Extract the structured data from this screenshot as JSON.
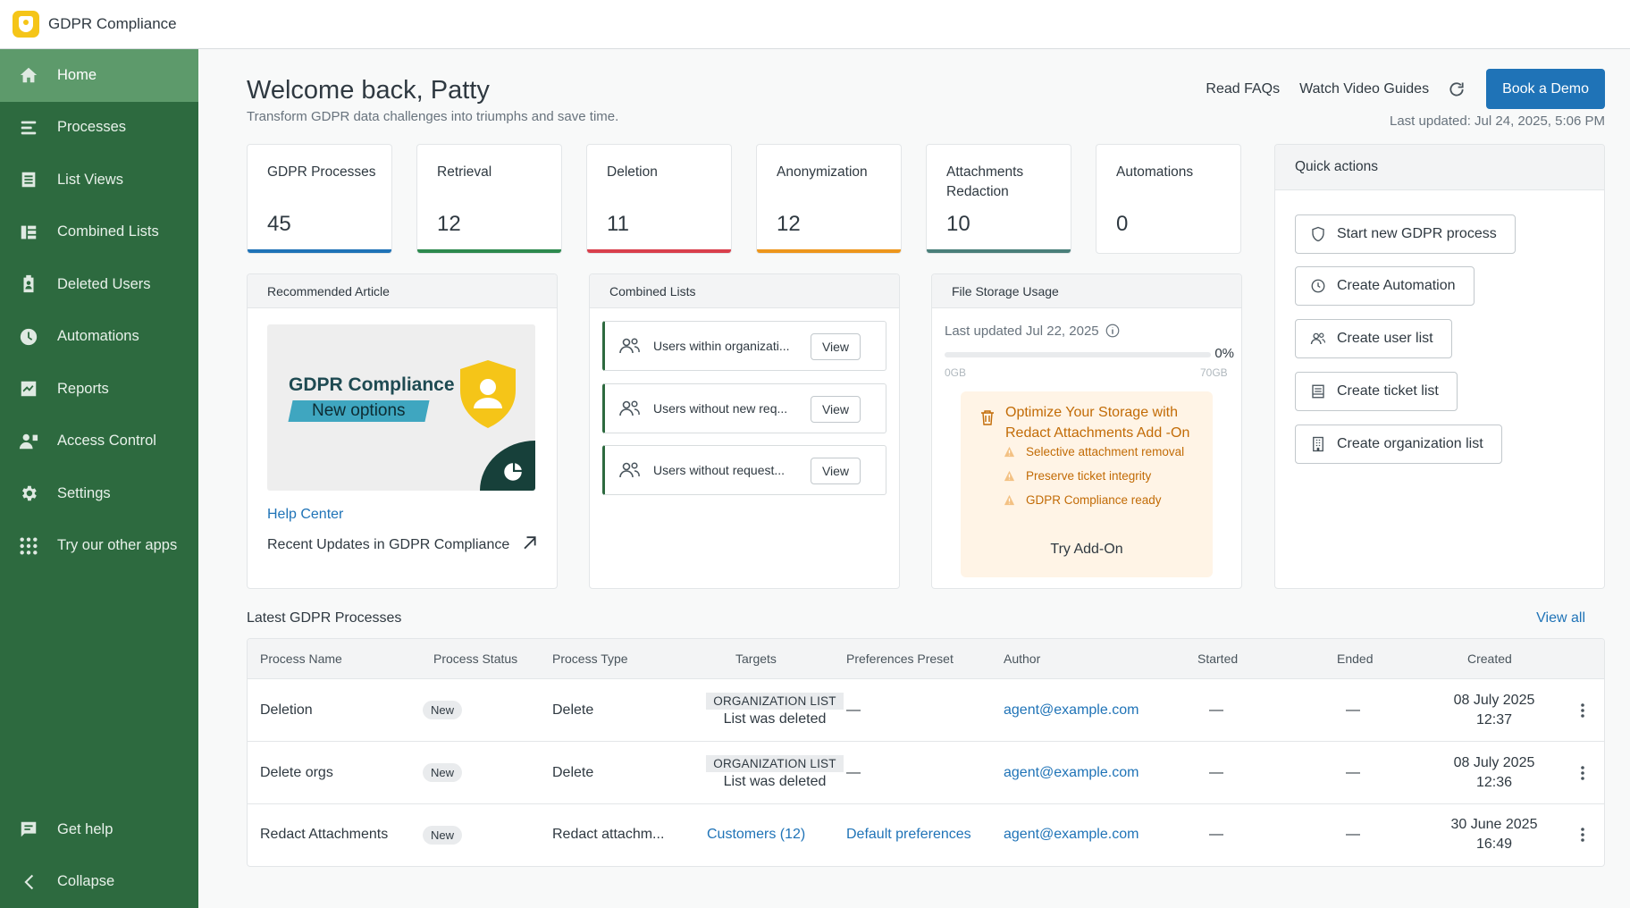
{
  "app": {
    "title": "GDPR Compliance"
  },
  "sidebar": {
    "items": [
      {
        "label": "Home",
        "icon": "home-icon"
      },
      {
        "label": "Processes",
        "icon": "processes-icon"
      },
      {
        "label": "List Views",
        "icon": "list-views-icon"
      },
      {
        "label": "Combined Lists",
        "icon": "combined-lists-icon"
      },
      {
        "label": "Deleted Users",
        "icon": "deleted-users-icon"
      },
      {
        "label": "Automations",
        "icon": "clock-icon"
      },
      {
        "label": "Reports",
        "icon": "chart-icon"
      },
      {
        "label": "Access Control",
        "icon": "access-control-icon"
      },
      {
        "label": "Settings",
        "icon": "gear-icon"
      },
      {
        "label": "Try our other apps",
        "icon": "grid-dots-icon"
      }
    ],
    "bottom": [
      {
        "label": "Get help",
        "icon": "chat-icon"
      },
      {
        "label": "Collapse",
        "icon": "chevron-left-icon"
      }
    ]
  },
  "header": {
    "welcome": "Welcome back, Patty",
    "subtitle": "Transform GDPR data challenges into triumphs and save time.",
    "read_faqs": "Read FAQs",
    "watch_guides": "Watch Video Guides",
    "book_demo": "Book a Demo",
    "last_updated": "Last updated: Jul 24, 2025, 5:06 PM"
  },
  "stats": [
    {
      "label": "GDPR Processes",
      "value": "45",
      "color": "#1f73b7"
    },
    {
      "label": "Retrieval",
      "value": "12",
      "color": "#2d8a4e"
    },
    {
      "label": "Deletion",
      "value": "11",
      "color": "#d93f4c"
    },
    {
      "label": "Anonymization",
      "value": "12",
      "color": "#ed961c"
    },
    {
      "label": "Attachments Redaction",
      "value": "10",
      "color": "#4a7f7a"
    },
    {
      "label": "Automations",
      "value": "0",
      "color": ""
    }
  ],
  "article": {
    "header": "Recommended Article",
    "image_title": "GDPR Compliance",
    "image_subtitle": "New options",
    "help_center": "Help Center",
    "recent_updates": "Recent Updates in GDPR Compliance"
  },
  "combined_lists": {
    "header": "Combined Lists",
    "items": [
      {
        "text": "Users within organizati...",
        "button": "View"
      },
      {
        "text": "Users without new req...",
        "button": "View"
      },
      {
        "text": "Users without request...",
        "button": "View"
      }
    ]
  },
  "storage": {
    "header": "File Storage Usage",
    "last_updated": "Last updated Jul 22, 2025",
    "percent": "0%",
    "fill": 0,
    "min": "0GB",
    "max": "70GB",
    "promo_title": "Optimize Your Storage with Redact Attachments Add -On",
    "promo_items": [
      "Selective attachment removal",
      "Preserve ticket integrity",
      "GDPR Compliance ready"
    ],
    "promo_cta": "Try Add-On"
  },
  "quick_actions": {
    "header": "Quick actions",
    "items": [
      {
        "label": "Start new GDPR process",
        "icon": "shield-icon"
      },
      {
        "label": "Create Automation",
        "icon": "clock-icon"
      },
      {
        "label": "Create user list",
        "icon": "users-icon"
      },
      {
        "label": "Create ticket list",
        "icon": "ticket-icon"
      },
      {
        "label": "Create organization list",
        "icon": "building-icon"
      }
    ]
  },
  "table": {
    "title": "Latest GDPR Processes",
    "view_all": "View all",
    "columns": [
      "Process Name",
      "Process Status",
      "Process Type",
      "Targets",
      "Preferences Preset",
      "Author",
      "Started",
      "Ended",
      "Created"
    ],
    "rows": [
      {
        "name": "Deletion",
        "status": "New",
        "type": "Delete",
        "target_tag": "ORGANIZATION LIST",
        "target_text": "List was deleted",
        "preset": "—",
        "author": "agent@example.com",
        "started": "—",
        "ended": "—",
        "created_date": "08 July 2025",
        "created_time": "12:37"
      },
      {
        "name": "Delete orgs",
        "status": "New",
        "type": "Delete",
        "target_tag": "ORGANIZATION LIST",
        "target_text": "List was deleted",
        "preset": "—",
        "author": "agent@example.com",
        "started": "—",
        "ended": "—",
        "created_date": "08 July 2025",
        "created_time": "12:36"
      },
      {
        "name": "Redact Attachments",
        "status": "New",
        "type": "Redact attachm...",
        "target_link": "Customers (12)",
        "preset": "Default preferences",
        "author": "agent@example.com",
        "started": "—",
        "ended": "—",
        "created_date": "30 June 2025",
        "created_time": "16:49"
      }
    ]
  }
}
